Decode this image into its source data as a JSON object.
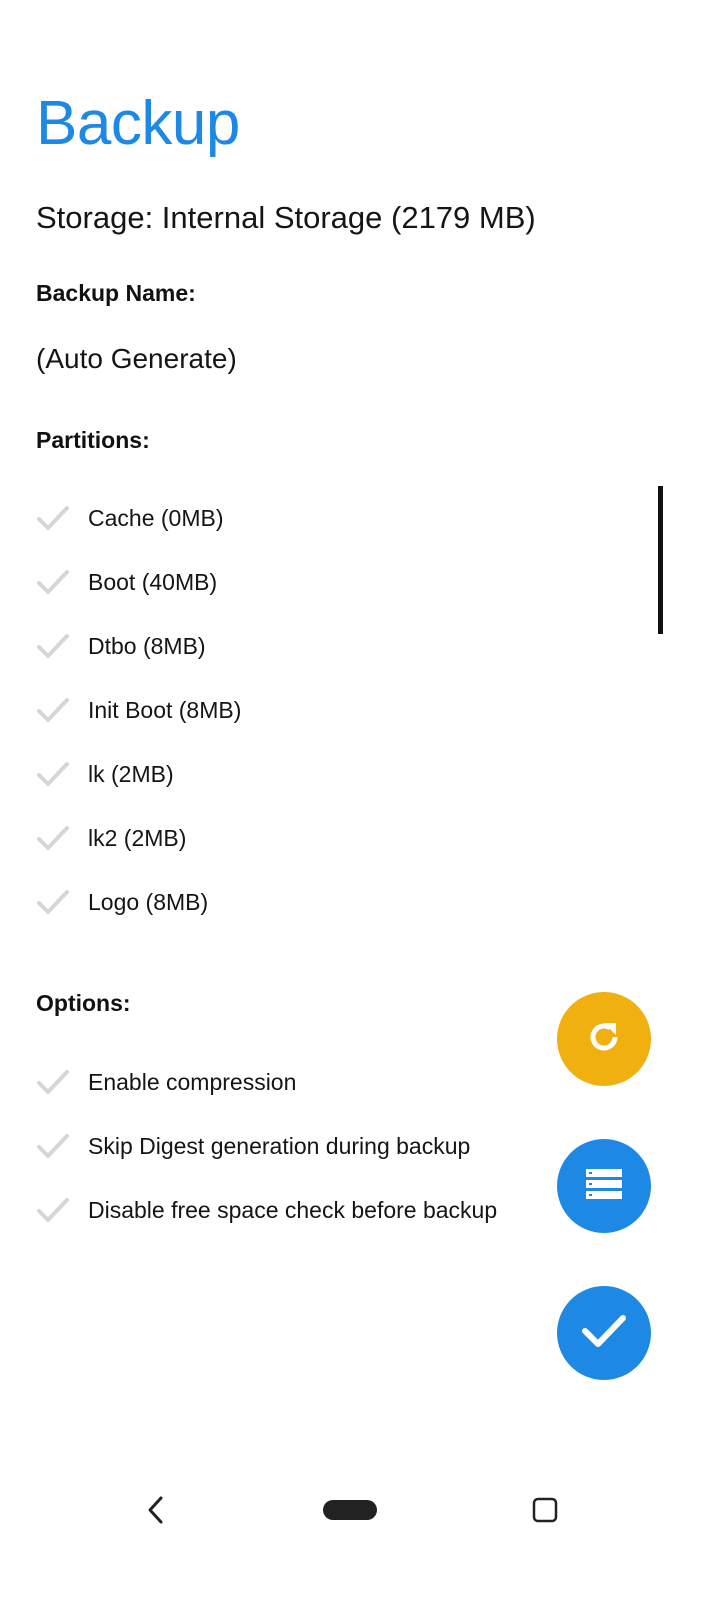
{
  "header": {
    "title": "Backup",
    "storage": "Storage: Internal Storage (2179 MB)"
  },
  "backup_name": {
    "label": "Backup Name:",
    "value": "(Auto Generate)"
  },
  "partitions": {
    "label": "Partitions:",
    "items": [
      {
        "label": "Cache (0MB)"
      },
      {
        "label": "Boot (40MB)"
      },
      {
        "label": "Dtbo (8MB)"
      },
      {
        "label": "Init Boot (8MB)"
      },
      {
        "label": "lk (2MB)"
      },
      {
        "label": "lk2 (2MB)"
      },
      {
        "label": "Logo (8MB)"
      }
    ]
  },
  "options": {
    "label": "Options:",
    "items": [
      {
        "label": "Enable compression"
      },
      {
        "label": "Skip Digest generation during backup"
      },
      {
        "label": "Disable free space check before backup"
      }
    ]
  },
  "fabs": {
    "refresh": {
      "icon": "refresh-icon",
      "color": "#f0b010"
    },
    "storage": {
      "icon": "storage-list-icon",
      "color": "#1e88e5"
    },
    "confirm": {
      "icon": "check-icon",
      "color": "#1e88e5"
    }
  },
  "navbar": {
    "back": {
      "icon": "back-chevron-icon"
    },
    "home": {
      "icon": "home-pill-icon"
    },
    "recents": {
      "icon": "recents-square-icon"
    }
  },
  "colors": {
    "accent": "#1e88e5",
    "refresh_fab": "#f0b010",
    "check_inactive": "#d6d6d6"
  }
}
